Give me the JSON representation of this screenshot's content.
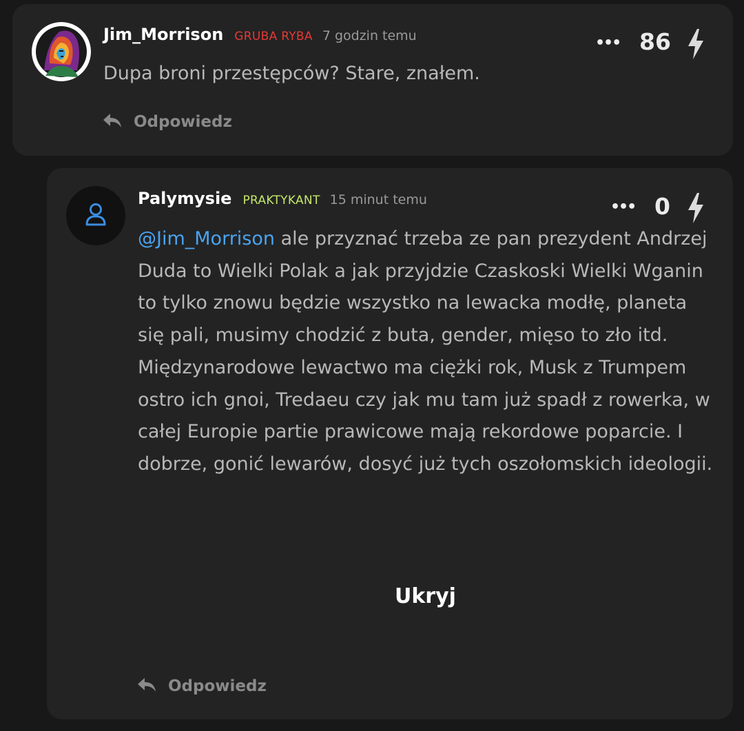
{
  "comments": [
    {
      "username": "Jim_Morrison",
      "rank": "GRUBA RYBA",
      "time": "7 godzin temu",
      "text": "Dupa broni przestępców? Stare, znałem.",
      "score": "86",
      "more_label": "•••",
      "reply_label": "Odpowiedz",
      "avatar_icon": "profile-photo",
      "rank_color": "#e53935"
    },
    {
      "username": "Palymysie",
      "rank": "PRAKTYKANT",
      "time": "15 minut temu",
      "mention": "@Jim_Morrison",
      "text": "ale przyznać trzeba ze pan prezydent Andrzej Duda to Wielki Polak a jak przyjdzie Czaskoski Wielki Wganin to tylko znowu będzie wszystko na lewacka modłę, planeta się pali, musimy chodzić z buta, gender, mięso to zło itd. Międzynarodowe lewactwo ma ciężki rok, Musk z Trumpem ostro ich gnoi, Tredaeu czy jak mu tam już spadł z rowerka, w całej Europie partie prawicowe mają rekordowe poparcie. I dobrze, gonić lewarów, dosyć już tych oszołomskich ideologii.",
      "score": "0",
      "more_label": "•••",
      "hide_label": "Ukryj",
      "reply_label": "Odpowiedz",
      "avatar_icon": "user-icon",
      "rank_color": "#c6e86a",
      "mention_color": "#4aa3f0"
    }
  ]
}
